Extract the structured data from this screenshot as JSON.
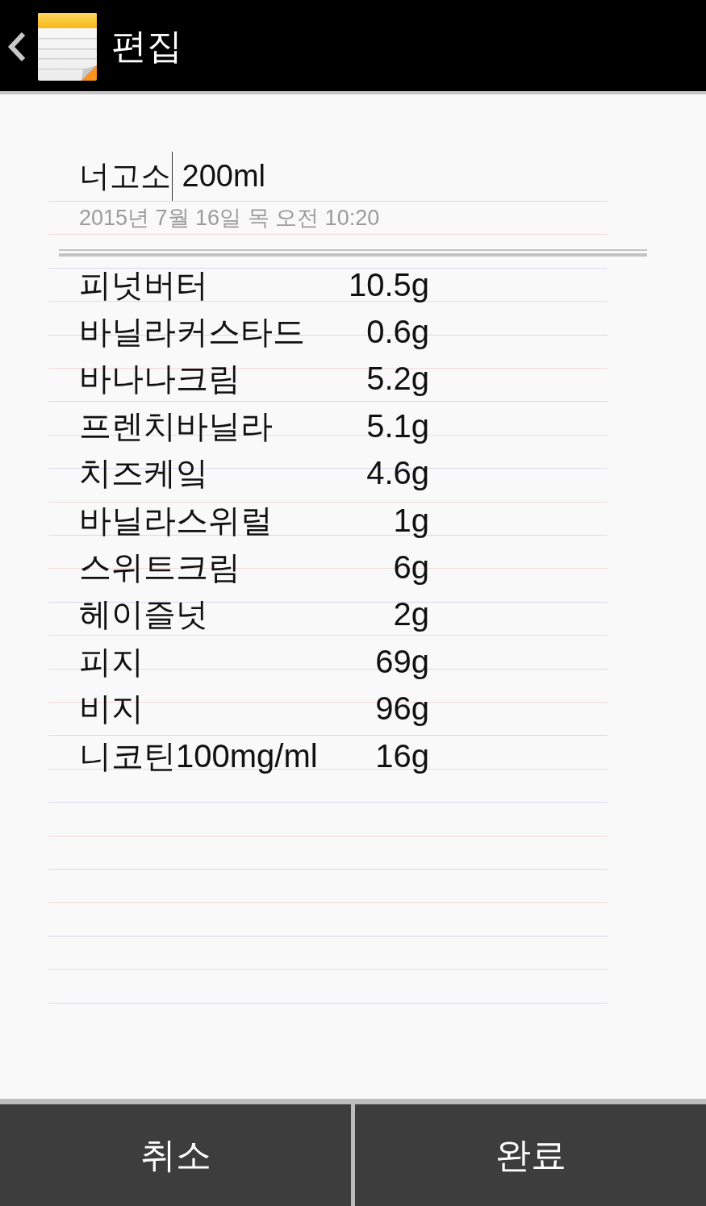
{
  "header": {
    "title": "편집"
  },
  "note": {
    "title": {
      "before_cursor": "너고소",
      "after_cursor": " 200ml"
    },
    "date": "2015년 7월 16일 목 오전 10:20",
    "items": [
      {
        "name": "피넛버터",
        "amount": "10.5g"
      },
      {
        "name": "바닐라커스타드",
        "amount": "0.6g"
      },
      {
        "name": "바나나크림",
        "amount": "5.2g"
      },
      {
        "name": "프렌치바닐라",
        "amount": "5.1g"
      },
      {
        "name": "치즈케잌",
        "amount": "4.6g"
      },
      {
        "name": "바닐라스위럴",
        "amount": "1g"
      },
      {
        "name": "스위트크림",
        "amount": "6g"
      },
      {
        "name": "헤이즐넛",
        "amount": "2g"
      },
      {
        "name": "피지",
        "amount": "69g"
      },
      {
        "name": "비지",
        "amount": "96g"
      },
      {
        "name": "니코틴100mg/ml",
        "amount": "16g"
      }
    ]
  },
  "buttons": [
    {
      "label": "취소"
    },
    {
      "label": "완료"
    }
  ]
}
